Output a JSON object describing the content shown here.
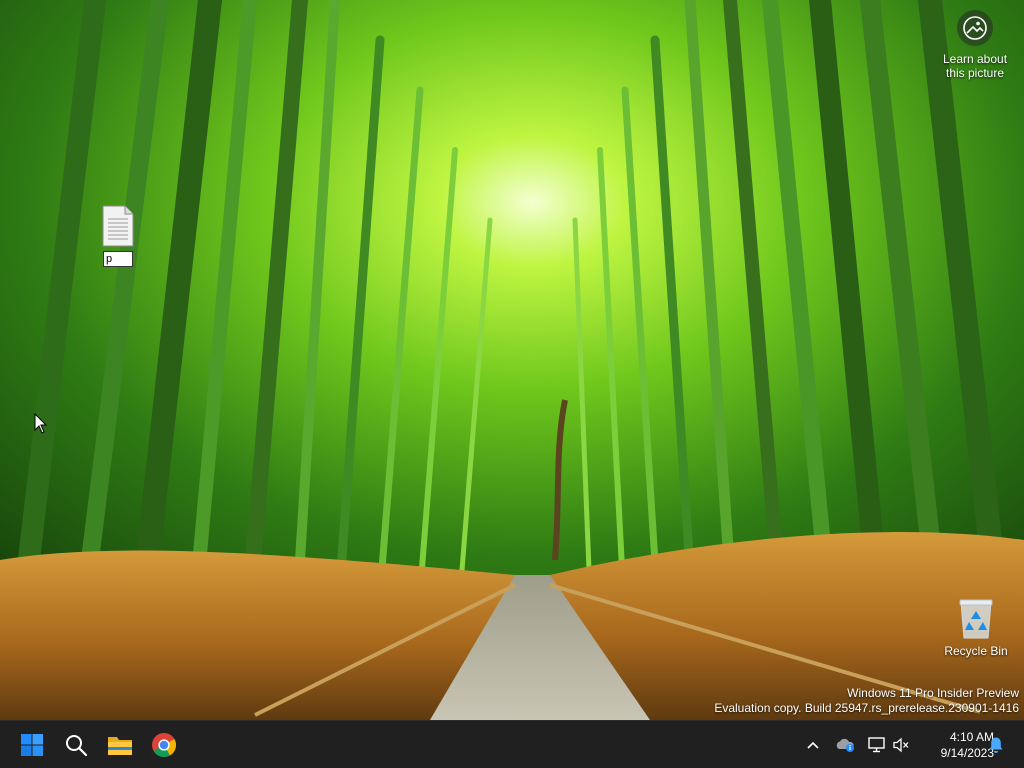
{
  "desktop": {
    "file_icon": {
      "rename_value": "p"
    },
    "recycle_bin": {
      "label": "Recycle Bin"
    },
    "learn_about": {
      "line1": "Learn about",
      "line2": "this picture"
    }
  },
  "watermark": {
    "line1": "Windows 11 Pro Insider Preview",
    "line2": "Evaluation copy. Build 25947.rs_prerelease.230901-1416"
  },
  "taskbar": {
    "apps": [
      "start-icon",
      "search-icon",
      "file-explorer-icon",
      "chrome-icon"
    ],
    "tray": [
      "chevron-up-icon",
      "onedrive-icon",
      "network-icon",
      "volume-muted-icon"
    ],
    "time": "4:10 AM",
    "date": "9/14/2023",
    "colors": {
      "background": "#202020",
      "start_blue": "#1f8cff"
    }
  }
}
